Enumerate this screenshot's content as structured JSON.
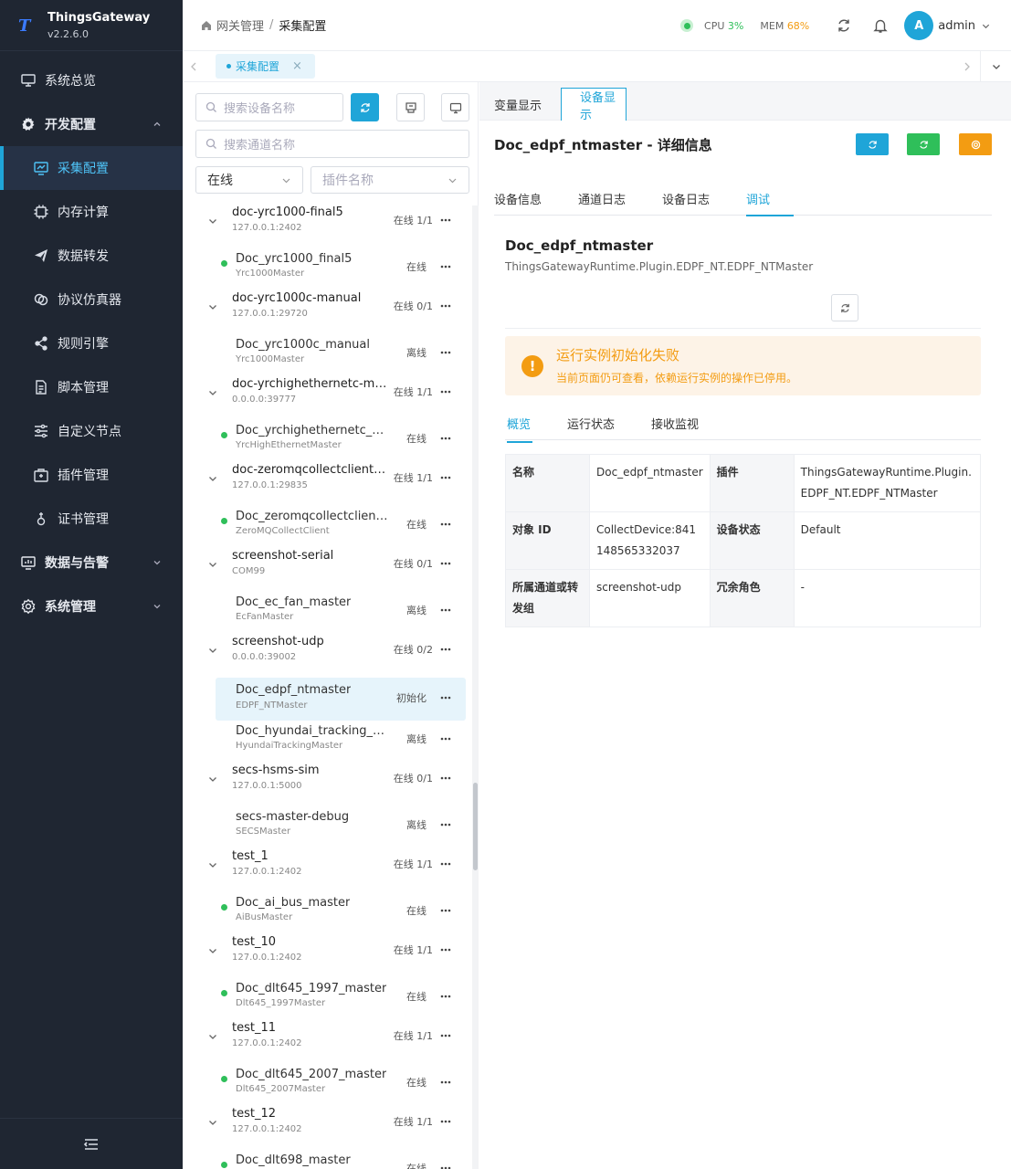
{
  "brand": {
    "name": "ThingsGateway",
    "version": "v2.2.6.0",
    "logo": "T"
  },
  "sidebar": {
    "items": [
      {
        "label": "系统总览",
        "icon": "monitor-icon",
        "type": "top"
      },
      {
        "label": "开发配置",
        "icon": "gear-icon",
        "type": "parent",
        "expanded": true
      },
      {
        "label": "采集配置",
        "icon": "chart-screen-icon",
        "type": "sub",
        "active": true
      },
      {
        "label": "内存计算",
        "icon": "chip-icon",
        "type": "sub"
      },
      {
        "label": "数据转发",
        "icon": "send-icon",
        "type": "sub"
      },
      {
        "label": "协议仿真器",
        "icon": "link-icon",
        "type": "sub"
      },
      {
        "label": "规则引擎",
        "icon": "share-icon",
        "type": "sub"
      },
      {
        "label": "脚本管理",
        "icon": "document-icon",
        "type": "sub"
      },
      {
        "label": "自定义节点",
        "icon": "sliders-icon",
        "type": "sub"
      },
      {
        "label": "插件管理",
        "icon": "box-icon",
        "type": "sub"
      },
      {
        "label": "证书管理",
        "icon": "certificate-icon",
        "type": "sub"
      },
      {
        "label": "数据与告警",
        "icon": "dashboard-icon",
        "type": "parent"
      },
      {
        "label": "系统管理",
        "icon": "settings-icon",
        "type": "parent"
      }
    ]
  },
  "breadcrumb": {
    "home": "网关管理",
    "sep": "/",
    "current": "采集配置"
  },
  "metrics": {
    "cpu_label": "CPU",
    "cpu_value": "3%",
    "mem_label": "MEM",
    "mem_value": "68%"
  },
  "user": {
    "avatar": "A",
    "name": "admin"
  },
  "page_tab": {
    "label": "采集配置",
    "close": "×"
  },
  "filters": {
    "device_search_placeholder": "搜索设备名称",
    "channel_search_placeholder": "搜索通道名称",
    "status_select": "在线",
    "plugin_select_placeholder": "插件名称"
  },
  "tree": [
    {
      "type": "channel",
      "name": "doc-yrc1000-final5",
      "addr": "127.0.0.1:2402",
      "status": "在线 1/1"
    },
    {
      "type": "device",
      "name": "Doc_yrc1000_final5",
      "plugin": "Yrc1000Master",
      "status": "在线",
      "online": true
    },
    {
      "type": "channel",
      "name": "doc-yrc1000c-manual",
      "addr": "127.0.0.1:29720",
      "status": "在线 0/1"
    },
    {
      "type": "device",
      "name": "Doc_yrc1000c_manual",
      "plugin": "Yrc1000Master",
      "status": "离线",
      "online": false
    },
    {
      "type": "channel",
      "name": "doc-yrchighethernetc-man...",
      "addr": "0.0.0.0:39777",
      "status": "在线 1/1"
    },
    {
      "type": "device",
      "name": "Doc_yrchighethernetc_manual",
      "plugin": "YrcHighEthernetMaster",
      "status": "在线",
      "online": true
    },
    {
      "type": "channel",
      "name": "doc-zeromqcollectclientfin...",
      "addr": "127.0.0.1:29835",
      "status": "在线 1/1"
    },
    {
      "type": "device",
      "name": "Doc_zeromqcollectclientfinal...",
      "plugin": "ZeroMQCollectClient",
      "status": "在线",
      "online": true
    },
    {
      "type": "channel",
      "name": "screenshot-serial",
      "addr": "COM99",
      "status": "在线 0/1"
    },
    {
      "type": "device",
      "name": "Doc_ec_fan_master",
      "plugin": "EcFanMaster",
      "status": "离线",
      "online": false
    },
    {
      "type": "channel",
      "name": "screenshot-udp",
      "addr": "0.0.0.0:39002",
      "status": "在线 0/2"
    },
    {
      "type": "device",
      "name": "Doc_edpf_ntmaster",
      "plugin": "EDPF_NTMaster",
      "status": "初始化",
      "online": false,
      "selected": true
    },
    {
      "type": "device",
      "name": "Doc_hyundai_tracking_master",
      "plugin": "HyundaiTrackingMaster",
      "status": "离线",
      "online": false
    },
    {
      "type": "channel",
      "name": "secs-hsms-sim",
      "addr": "127.0.0.1:5000",
      "status": "在线 0/1"
    },
    {
      "type": "device",
      "name": "secs-master-debug",
      "plugin": "SECSMaster",
      "status": "离线",
      "online": false
    },
    {
      "type": "channel",
      "name": "test_1",
      "addr": "127.0.0.1:2402",
      "status": "在线 1/1"
    },
    {
      "type": "device",
      "name": "Doc_ai_bus_master",
      "plugin": "AiBusMaster",
      "status": "在线",
      "online": true
    },
    {
      "type": "channel",
      "name": "test_10",
      "addr": "127.0.0.1:2402",
      "status": "在线 1/1"
    },
    {
      "type": "device",
      "name": "Doc_dlt645_1997_master",
      "plugin": "Dlt645_1997Master",
      "status": "在线",
      "online": true
    },
    {
      "type": "channel",
      "name": "test_11",
      "addr": "127.0.0.1:2402",
      "status": "在线 1/1"
    },
    {
      "type": "device",
      "name": "Doc_dlt645_2007_master",
      "plugin": "Dlt645_2007Master",
      "status": "在线",
      "online": true
    },
    {
      "type": "channel",
      "name": "test_12",
      "addr": "127.0.0.1:2402",
      "status": "在线 1/1"
    },
    {
      "type": "device",
      "name": "Doc_dlt698_master",
      "plugin": "Dlt698Master",
      "status": "在线",
      "online": true
    }
  ],
  "right": {
    "view_tabs": [
      "变量显示",
      "设备显示"
    ],
    "detail_title": "Doc_edpf_ntmaster - 详细信息",
    "sub_tabs": [
      "设备信息",
      "通道日志",
      "设备日志",
      "调试"
    ],
    "device_name": "Doc_edpf_ntmaster",
    "device_plugin": "ThingsGatewayRuntime.Plugin.EDPF_NT.EDPF_NTMaster",
    "warning_title": "运行实例初始化失败",
    "warning_text": "当前页面仍可查看，依赖运行实例的操作已停用。",
    "inner_tabs": [
      "概览",
      "运行状态",
      "接收监视"
    ],
    "info": {
      "name_label": "名称",
      "name_value": "Doc_edpf_ntmaster",
      "plugin_label": "插件",
      "plugin_value": "ThingsGatewayRuntime.Plugin.EDPF_NT.EDPF_NTMaster",
      "id_label": "对象 ID",
      "id_value": "CollectDevice:841148565332037",
      "state_label": "设备状态",
      "state_value": "Default",
      "channel_label": "所属通道或转发组",
      "channel_value": "screenshot-udp",
      "role_label": "冗余角色",
      "role_value": "-"
    }
  },
  "colors": {
    "accent": "#1fa5d8",
    "online": "#2fbf5a",
    "warning": "#f39c12",
    "sidebar": "#1f2632"
  }
}
